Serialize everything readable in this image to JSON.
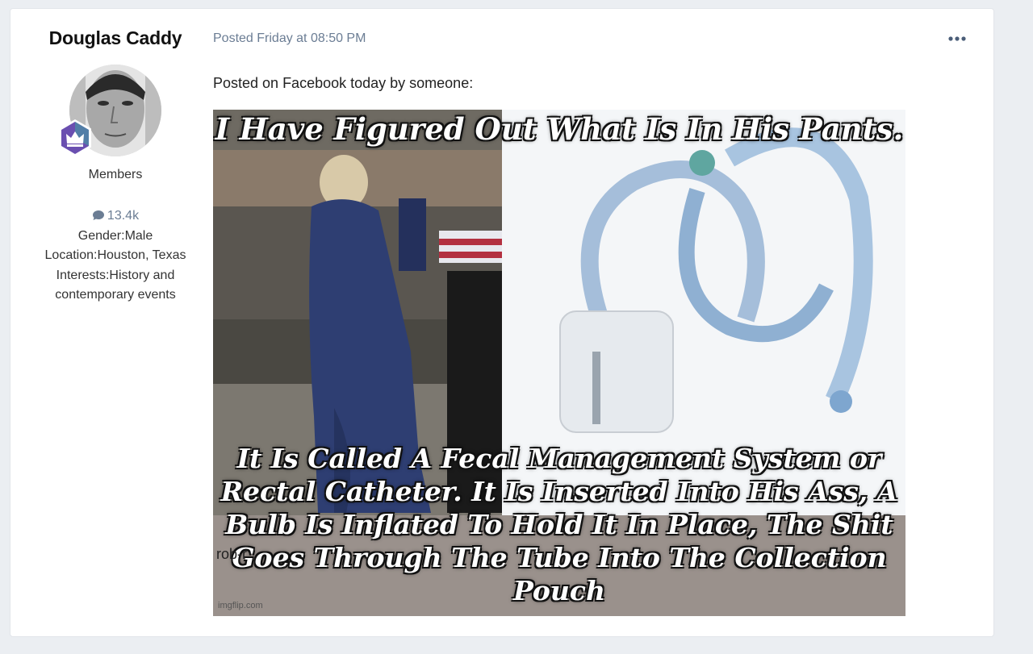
{
  "author": {
    "name": "Douglas Caddy",
    "group": "Members",
    "post_count": "13.4k",
    "gender": "Gender:Male",
    "location": "Location:Houston, Texas",
    "interests": "Interests:History and contemporary events"
  },
  "post": {
    "meta": "Posted Friday at 08:50 PM",
    "text": "Posted on Facebook today by someone:",
    "image": {
      "caption_top": "I Have Figured Out What Is In His Pants.",
      "caption_bottom": "It Is Called A Fecal Management System or Rectal Catheter. It Is Inserted Into His Ass, A Bulb Is Inflated To Hold It In Place, The Shit Goes Through The Tube Into The Collection Pouch",
      "watermark_left": "rob-r",
      "watermark_bottom": "imgflip.com"
    }
  },
  "icons": {
    "more": "ellipsis-icon",
    "comment": "comment-icon",
    "badge": "crown-badge-icon"
  },
  "colors": {
    "meta": "#6b7d94",
    "badge": "#6a4fb0",
    "background": "#ebeef2"
  }
}
